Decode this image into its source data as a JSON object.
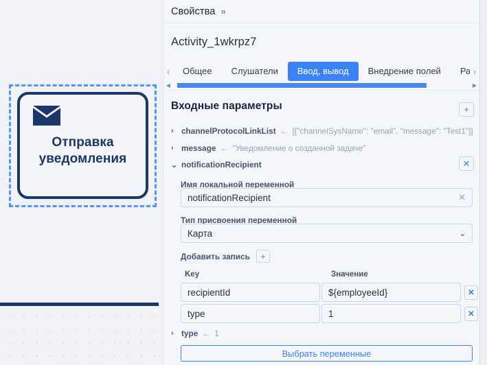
{
  "canvas": {
    "task_node": {
      "label_line1": "Отправка",
      "label_line2": "уведомления",
      "icon": "envelope-icon",
      "border_color": "#1b3668",
      "selection_color": "#4d94ff"
    },
    "pool_divider_color": "#1b3668",
    "background_color": "#f0f2f7"
  },
  "panel": {
    "header": {
      "title": "Свойства",
      "collapse_chevron": "»"
    },
    "activity_name": "Activity_1wkrpz7",
    "tabs": {
      "prev_arrow": "‹",
      "next_arrow": "›",
      "items": [
        {
          "label": "Общее",
          "active": false
        },
        {
          "label": "Слушатели",
          "active": false
        },
        {
          "label": "Ввод, вывод",
          "active": true
        },
        {
          "label": "Внедрение полей",
          "active": false
        },
        {
          "label": "Рас",
          "active": false
        }
      ],
      "active_color": "#3b82f6",
      "scrollbar": {
        "left_arrow": "◀",
        "right_arrow": "▶",
        "thumb_color": "#4a88f0"
      }
    },
    "section": {
      "title": "Входные параметры",
      "add_button_label": "+"
    },
    "parameters": [
      {
        "caret": "›",
        "name": "channelProtocolLinkList",
        "arrow": "←",
        "value": "[[\"channelSysName\": \"email\", \"message\": \"Test1\"]]",
        "expanded": false,
        "has_delete": false
      },
      {
        "caret": "›",
        "name": "message",
        "arrow": "←",
        "value": "\"Уведомление о созданной задаче\"",
        "expanded": false,
        "has_delete": false
      },
      {
        "caret": "⌄",
        "name": "notificationRecipient",
        "arrow": "",
        "value": "",
        "expanded": true,
        "has_delete": true,
        "delete_label": "✕"
      }
    ],
    "expanded_param": {
      "local_var_name": {
        "label": "Имя локальной переменной",
        "value": "notificationRecipient",
        "clear_icon": "✕"
      },
      "assignment_type": {
        "label": "Тип присвоения переменной",
        "value": "Карта",
        "chevron": "⌄",
        "options": [
          "Карта"
        ]
      },
      "add_record": {
        "label": "Добавить запись",
        "button_label": "+"
      },
      "kv_table": {
        "columns": [
          "Key",
          "Значение"
        ],
        "rows": [
          {
            "key": "recipientId",
            "value": "${employeeId}",
            "delete_label": "✕"
          },
          {
            "key": "type",
            "value": "1",
            "delete_label": "✕"
          }
        ]
      }
    },
    "trailing_parameter": {
      "caret": "›",
      "name": "type",
      "arrow": "←",
      "value": "1"
    },
    "select_variables_button": "Выбрать переменные"
  }
}
